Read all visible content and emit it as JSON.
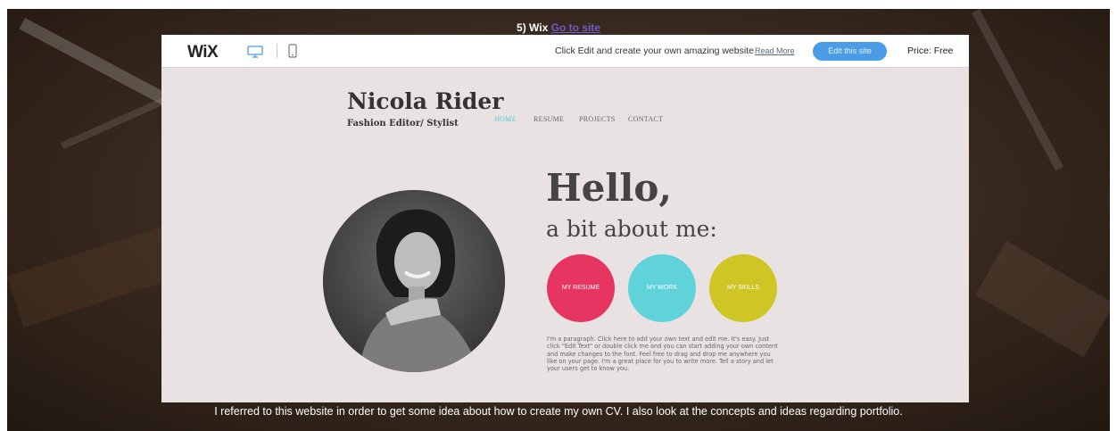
{
  "headline": {
    "prefix": "5) Wix ",
    "link": "Go to site"
  },
  "wix_bar": {
    "logo": "WiX",
    "promo_text": "Click Edit and create your own amazing website",
    "read_more": "Read More",
    "edit_button": "Edit this site",
    "price": "Price: Free"
  },
  "site": {
    "name": "Nicola Rider",
    "role": "Fashion Editor/ Stylist",
    "nav": [
      "HOME",
      "RESUME",
      "PROJECTS",
      "CONTACT"
    ],
    "hello": "Hello,",
    "subtitle": "a bit about me:",
    "circles": [
      {
        "label": "MY RESUME",
        "color": "#e63560"
      },
      {
        "label": "MY WORK",
        "color": "#5fd2da"
      },
      {
        "label": "MY SKILLS",
        "color": "#cfc524"
      }
    ],
    "paragraph": "I'm a paragraph. Click here to add your own text and edit me. It's easy. Just click \"Edit Text\" or double click me and you can start adding your own content and make changes to the font. Feel free to drag and drop me anywhere you like on your page. I'm a great place for you to write more. Tell a story and let your users get to know you."
  },
  "caption": "I referred to this website in order to get some idea about how to create my own CV. I also look at the concepts and ideas regarding portfolio.",
  "icons": {
    "desktop": "desktop-monitor-icon",
    "mobile": "mobile-phone-icon"
  },
  "colors": {
    "accent_blue": "#4a9ce6",
    "nav_active": "#5ecad4",
    "page_bg": "#e8e3e2"
  }
}
